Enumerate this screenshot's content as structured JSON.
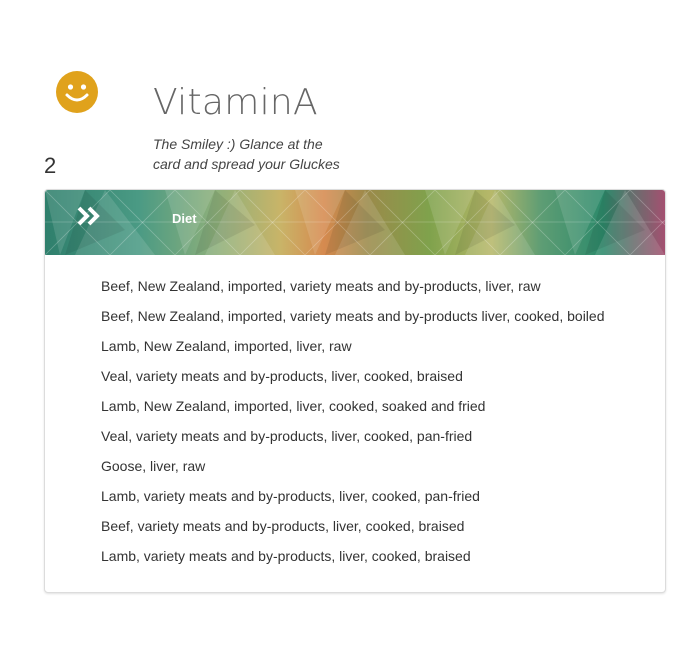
{
  "header": {
    "smiley_icon": "smiley-face-icon",
    "smiley_color": "#E0A21C",
    "number": "2",
    "title": "VitaminA",
    "subtitle_line1": "The Smiley :) Glance at the",
    "subtitle_line2": "card and spread your Gluckes"
  },
  "card": {
    "banner_icon": "double-chevron-right-icon",
    "banner_label": "Diet",
    "items": [
      "Beef, New Zealand, imported, variety meats and by-products, liver, raw",
      "Beef, New Zealand, imported, variety meats and by-products liver, cooked, boiled",
      "Lamb, New Zealand, imported, liver, raw",
      "Veal, variety meats and by-products, liver, cooked, braised",
      "Lamb, New Zealand, imported, liver, cooked, soaked and fried",
      "Veal, variety meats and by-products, liver, cooked, pan-fried",
      "Goose, liver, raw",
      "Lamb, variety meats and by-products, liver, cooked, pan-fried",
      "Beef, variety meats and by-products, liver, cooked, braised",
      "Lamb, variety meats and by-products, liver, cooked, braised"
    ]
  }
}
